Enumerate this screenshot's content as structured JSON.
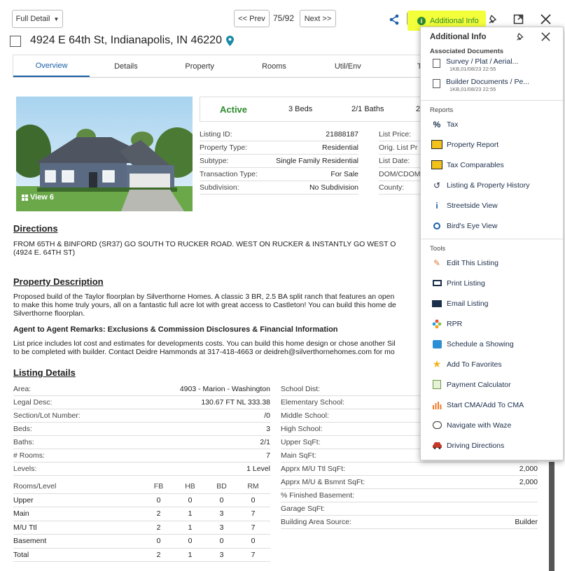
{
  "toolbar": {
    "view_select": "Full Detail",
    "prev_label": "<< Prev",
    "counter": "75/92",
    "next_label": "Next >>",
    "additional_info_label": "Additional Info"
  },
  "listing_header": {
    "address": "4924 E 64th St, Indianapolis, IN 46220"
  },
  "tabs": [
    "Overview",
    "Details",
    "Property",
    "Rooms",
    "Util/Env",
    "Tax"
  ],
  "photo": {
    "view_label": "View 6"
  },
  "status_bar": {
    "status": "Active",
    "beds": "3 Beds",
    "baths": "2/1 Baths",
    "extra": "2"
  },
  "summary_left": [
    {
      "k": "Listing ID:",
      "v": "21888187"
    },
    {
      "k": "Property Type:",
      "v": "Residential"
    },
    {
      "k": "Subtype:",
      "v": "Single Family Residential"
    },
    {
      "k": "Transaction Type:",
      "v": "For Sale"
    },
    {
      "k": "Subdivision:",
      "v": "No Subdivision"
    }
  ],
  "summary_right": [
    "List Price:",
    "Orig. List Pr",
    "List Date:",
    "DOM/CDOM",
    "County:"
  ],
  "directions": {
    "heading": "Directions",
    "text": "FROM 65TH & BINFORD (SR37) GO SOUTH TO RUCKER ROAD. WEST ON RUCKER & INSTANTLY GO WEST O\n(4924 E. 64TH ST)"
  },
  "property_description": {
    "heading": "Property Description",
    "text": "Proposed build of the Taylor floorplan by Silverthorne Homes. A classic 3 BR, 2.5 BA split ranch that features an open\nto make this home truly yours, all on a fantastic full acre lot with great access to Castleton! You can build this home de\nSilverthorne floorplan.",
    "agent_heading": "Agent to Agent Remarks: Exclusions & Commission Disclosures & Financial Information",
    "agent_text": "List price includes lot cost and estimates for developments costs. You can build this home design or chose another Sil\nto be completed with builder. Contact Deidre Hammonds at 317-418-4663 or deidreh@silverthornehomes.com for mo"
  },
  "listing_details": {
    "heading": "Listing Details",
    "left": [
      {
        "k": "Area:",
        "v": "4903 - Marion - Washington"
      },
      {
        "k": "Legal Desc:",
        "v": "130.67 FT NL 333.38"
      },
      {
        "k": "Section/Lot Number:",
        "v": "/0"
      },
      {
        "k": "Beds:",
        "v": "3"
      },
      {
        "k": "Baths:",
        "v": "2/1"
      },
      {
        "k": "# Rooms:",
        "v": "7"
      },
      {
        "k": "Levels:",
        "v": "1 Level"
      }
    ],
    "right": [
      {
        "k": "School Dist:",
        "v": ""
      },
      {
        "k": "Elementary School:",
        "v": ""
      },
      {
        "k": "Middle School:",
        "v": ""
      },
      {
        "k": "High School:",
        "v": ""
      },
      {
        "k": "Upper SqFt:",
        "v": ""
      },
      {
        "k": "Main SqFt:",
        "v": ""
      },
      {
        "k": "Apprx M/U Ttl SqFt:",
        "v": "2,000"
      },
      {
        "k": "Apprx M/U & Bsmnt SqFt:",
        "v": "2,000"
      },
      {
        "k": "% Finished Basement:",
        "v": ""
      },
      {
        "k": "Garage SqFt:",
        "v": ""
      },
      {
        "k": "Building Area Source:",
        "v": "Builder"
      }
    ],
    "rooms_table": {
      "headers": [
        "Rooms/Level",
        "FB",
        "HB",
        "BD",
        "RM"
      ],
      "rows": [
        [
          "Upper",
          "0",
          "0",
          "0",
          "0"
        ],
        [
          "Main",
          "2",
          "1",
          "3",
          "7"
        ],
        [
          "M/U Ttl",
          "2",
          "1",
          "3",
          "7"
        ],
        [
          "Basement",
          "0",
          "0",
          "0",
          "0"
        ],
        [
          "Total",
          "2",
          "1",
          "3",
          "7"
        ]
      ]
    }
  },
  "menu": {
    "title": "Additional Info",
    "associated_heading": "Associated Documents",
    "documents": [
      {
        "name": "Survey / Plat / Aerial...",
        "meta": "1KB,01/08/23 22:55"
      },
      {
        "name": "Builder Documents / Pe...",
        "meta": "1KB,01/08/23 22:55"
      }
    ],
    "reports_heading": "Reports",
    "reports": [
      {
        "label": "Tax",
        "icon": "percent-icon"
      },
      {
        "label": "Property Report",
        "icon": "report-icon"
      },
      {
        "label": "Tax Comparables",
        "icon": "tax-comparables-icon"
      },
      {
        "label": "Listing & Property History",
        "icon": "history-icon"
      },
      {
        "label": "Streetside View",
        "icon": "pegman-icon"
      },
      {
        "label": "Bird's Eye View",
        "icon": "birds-eye-icon"
      }
    ],
    "tools_heading": "Tools",
    "tools": [
      {
        "label": "Edit This Listing",
        "icon": "pencil-icon"
      },
      {
        "label": "Print Listing",
        "icon": "printer-icon"
      },
      {
        "label": "Email Listing",
        "icon": "email-icon"
      },
      {
        "label": "RPR",
        "icon": "rpr-icon"
      },
      {
        "label": "Schedule a Showing",
        "icon": "calendar-icon"
      },
      {
        "label": "Add To Favorites",
        "icon": "star-icon"
      },
      {
        "label": "Payment Calculator",
        "icon": "calculator-icon"
      },
      {
        "label": "Start CMA/Add To CMA",
        "icon": "chart-icon"
      },
      {
        "label": "Navigate with Waze",
        "icon": "waze-icon"
      },
      {
        "label": "Driving Directions",
        "icon": "car-icon"
      }
    ]
  },
  "colors": {
    "accent_blue": "#1a5fa8",
    "status_green": "#2e8b2e",
    "highlight_yellow": "#f3ff3a",
    "menu_text": "#1b2e4a"
  }
}
